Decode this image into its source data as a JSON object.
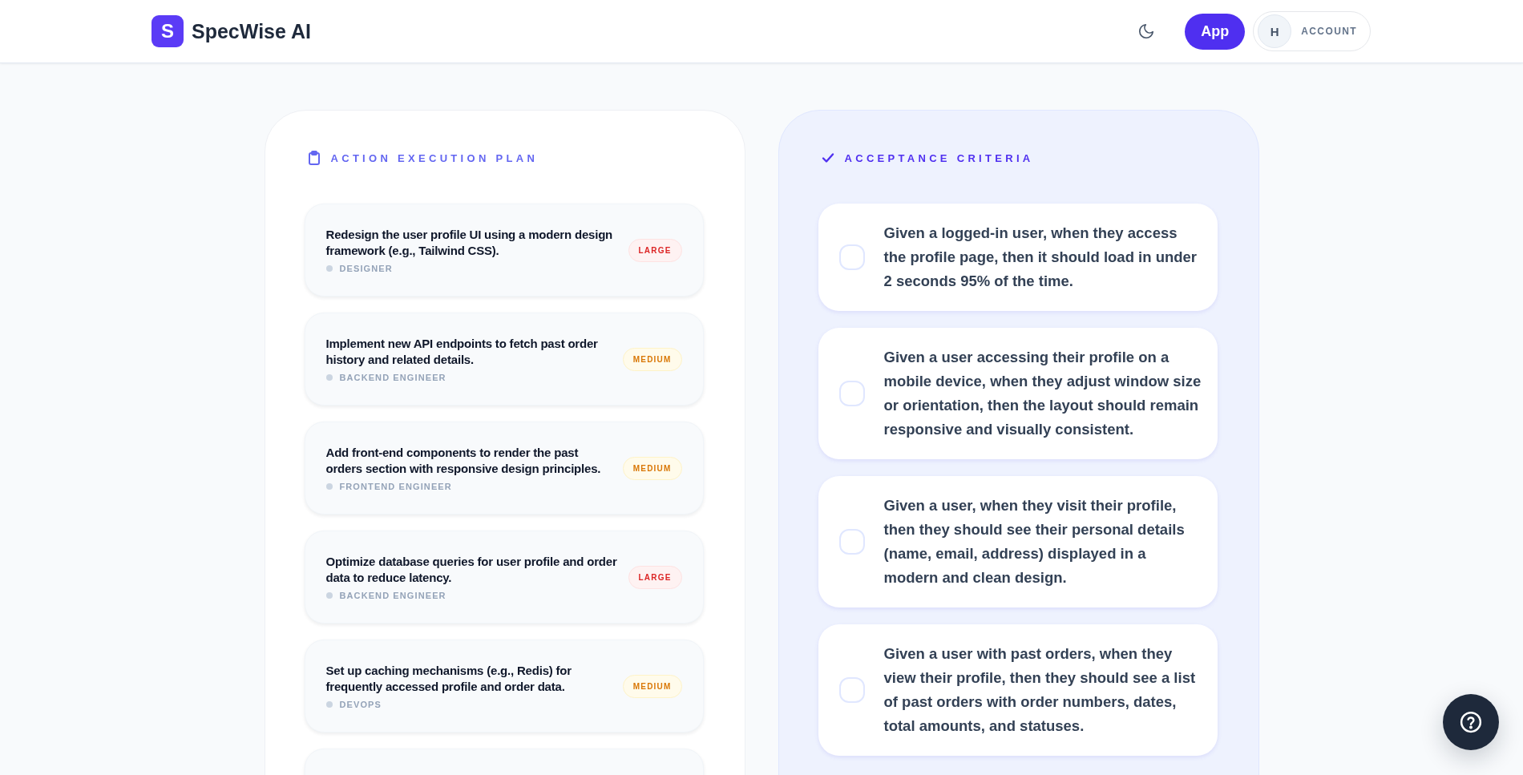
{
  "header": {
    "logo_letter": "S",
    "brand": "SpecWise AI",
    "app_button": "App",
    "account": {
      "initial": "H",
      "label": "ACCOUNT"
    }
  },
  "plan": {
    "title": "ACTION EXECUTION PLAN",
    "tasks": [
      {
        "text": "Redesign the user profile UI using a modern design framework (e.g., Tailwind CSS).",
        "role": "DESIGNER",
        "size": {
          "kind": "large",
          "label": "LARGE"
        }
      },
      {
        "text": "Implement new API endpoints to fetch past order history and related details.",
        "role": "BACKEND ENGINEER",
        "size": {
          "kind": "medium",
          "label": "MEDIUM"
        }
      },
      {
        "text": "Add front-end components to render the past orders section with responsive design principles.",
        "role": "FRONTEND ENGINEER",
        "size": {
          "kind": "medium",
          "label": "MEDIUM"
        }
      },
      {
        "text": "Optimize database queries for user profile and order data to reduce latency.",
        "role": "BACKEND ENGINEER",
        "size": {
          "kind": "large",
          "label": "LARGE"
        }
      },
      {
        "text": "Set up caching mechanisms (e.g., Redis) for frequently accessed profile and order data.",
        "role": "DEVOPS",
        "size": {
          "kind": "medium",
          "label": "MEDIUM"
        }
      }
    ]
  },
  "criteria": {
    "title": "ACCEPTANCE CRITERIA",
    "items": [
      {
        "text": "Given a logged-in user, when they access the profile page, then it should load in under 2 seconds 95% of the time.",
        "checked": false
      },
      {
        "text": "Given a user accessing their profile on a mobile device, when they adjust window size or orientation, then the layout should remain responsive and visually consistent.",
        "checked": false
      },
      {
        "text": "Given a user, when they visit their profile, then they should see their personal details (name, email, address) displayed in a modern and clean design.",
        "checked": false
      },
      {
        "text": "Given a user with past orders, when they view their profile, then they should see a list of past orders with order numbers, dates, total amounts, and statuses.",
        "checked": false
      }
    ]
  }
}
